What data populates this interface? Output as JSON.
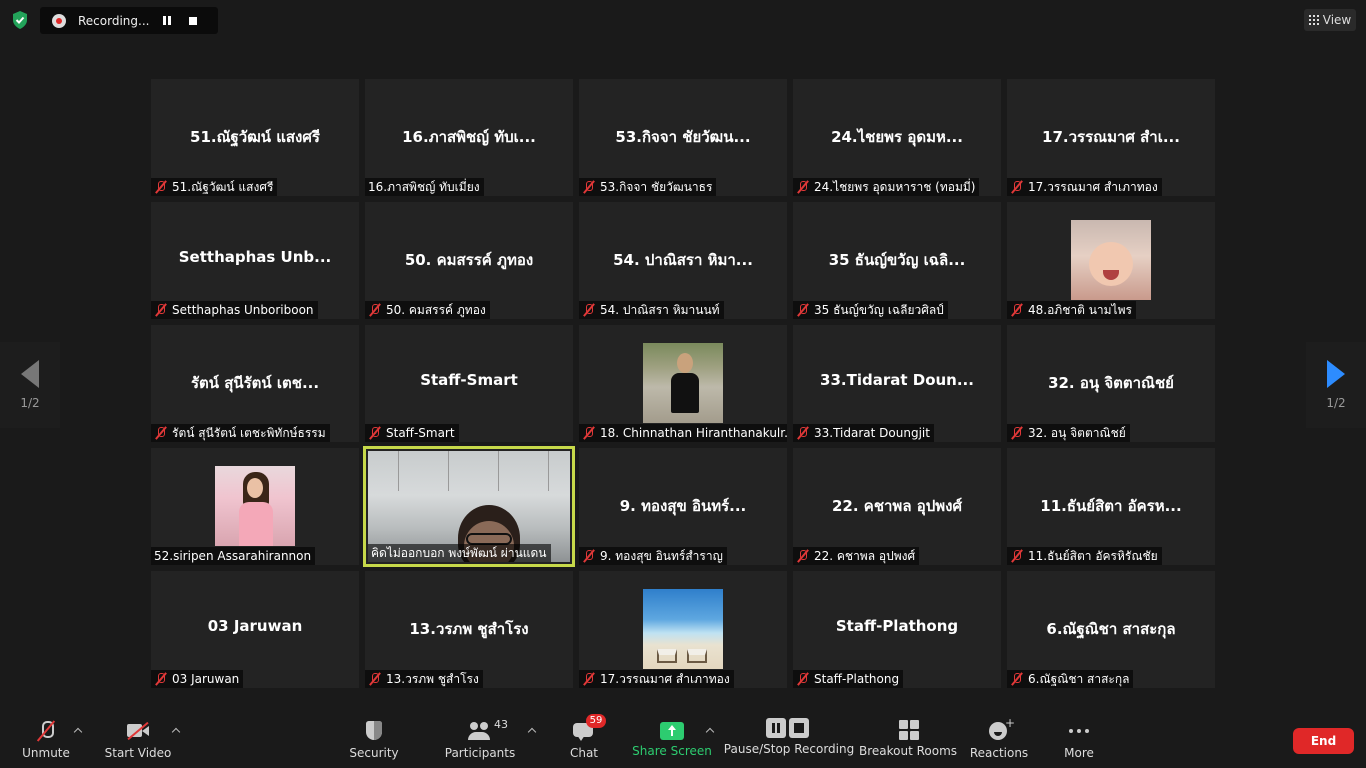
{
  "recording": {
    "status": "Recording..."
  },
  "view": {
    "label": "View"
  },
  "pager": {
    "left": "1/2",
    "right": "1/2"
  },
  "tiles": [
    {
      "name": "51.ณัฐวัฒน์ แสงศรี",
      "label": "51.ณัฐวัฒน์ แสงศรี"
    },
    {
      "name": "16.ภาสพิชญ์ ทับเ...",
      "label": "16.ภาสพิชญ์ ทับเมี่ยง"
    },
    {
      "name": "53.กิจจา ชัยวัฒน...",
      "label": "53.กิจจา ชัยวัฒนาธร"
    },
    {
      "name": "24.ไชยพร อุดมห...",
      "label": "24.ไชยพร อุดมหาราช (ทอมมี่)"
    },
    {
      "name": "17.วรรณมาศ สำเ...",
      "label": "17.วรรณมาศ สำเภาทอง"
    },
    {
      "name": "Setthaphas Unb...",
      "label": "Setthaphas Unboriboon"
    },
    {
      "name": "50. คมสรรค์ ภูทอง",
      "label": "50. คมสรรค์ ภูทอง"
    },
    {
      "name": "54. ปาณิสรา หิมา...",
      "label": "54. ปาณิสรา หิมานนท์"
    },
    {
      "name": "35 ธันญ์ขวัญ เฉลิ...",
      "label": "35 ธันญ์ขวัญ เฉลียวศิลป์"
    },
    {
      "name": "",
      "label": "48.อภิชาติ นามไพร"
    },
    {
      "name": "รัตน์ สุนีรัตน์ เตช...",
      "label": "รัตน์ สุนีรัตน์ เตชะพิทักษ์ธรรม"
    },
    {
      "name": "Staff-Smart",
      "label": "Staff-Smart"
    },
    {
      "name": "",
      "label": "18. Chinnathan Hiranthanakulr..."
    },
    {
      "name": "33.Tidarat Doun...",
      "label": "33.Tidarat Doungjit"
    },
    {
      "name": "32. อนุ จิตตาณิชย์",
      "label": "32. อนุ จิตตาณิชย์"
    },
    {
      "name": "",
      "label": "52.siripen Assarahirannon"
    },
    {
      "name": "",
      "label": "คิดไม่ออกบอก พงษ์พัฒน์ ผ่านแดน"
    },
    {
      "name": "9. ทองสุข อินทร์...",
      "label": "9. ทองสุข อินทร์สำราญ"
    },
    {
      "name": "22. คชาพล อุปพงศ์",
      "label": "22. คชาพล อุปพงศ์"
    },
    {
      "name": "11.ธันย์สิตา อัครห...",
      "label": "11.ธันย์สิตา อัครหิรัณชัย"
    },
    {
      "name": "03 Jaruwan",
      "label": "03 Jaruwan"
    },
    {
      "name": "13.วรภพ ชูสำโรง",
      "label": "13.วรภพ ชูสำโรง"
    },
    {
      "name": "",
      "label": "17.วรรณมาศ สำเภาทอง"
    },
    {
      "name": "Staff-Plathong",
      "label": "Staff-Plathong"
    },
    {
      "name": "6.ณัฐณิชา สาสะกุล",
      "label": "6.ณัฐณิชา สาสะกุล"
    }
  ],
  "toolbar": {
    "unmute": "Unmute",
    "start_video": "Start Video",
    "security": "Security",
    "participants": "Participants",
    "participants_count": "43",
    "chat": "Chat",
    "chat_badge": "59",
    "share_screen": "Share Screen",
    "recording": "Pause/Stop Recording",
    "breakout": "Breakout Rooms",
    "reactions": "Reactions",
    "more": "More",
    "end": "End"
  },
  "colors": {
    "accent_green": "#2dcc70",
    "end_red": "#e02828",
    "active_speaker": "#c7d94a",
    "nav_blue": "#2d8cff"
  }
}
